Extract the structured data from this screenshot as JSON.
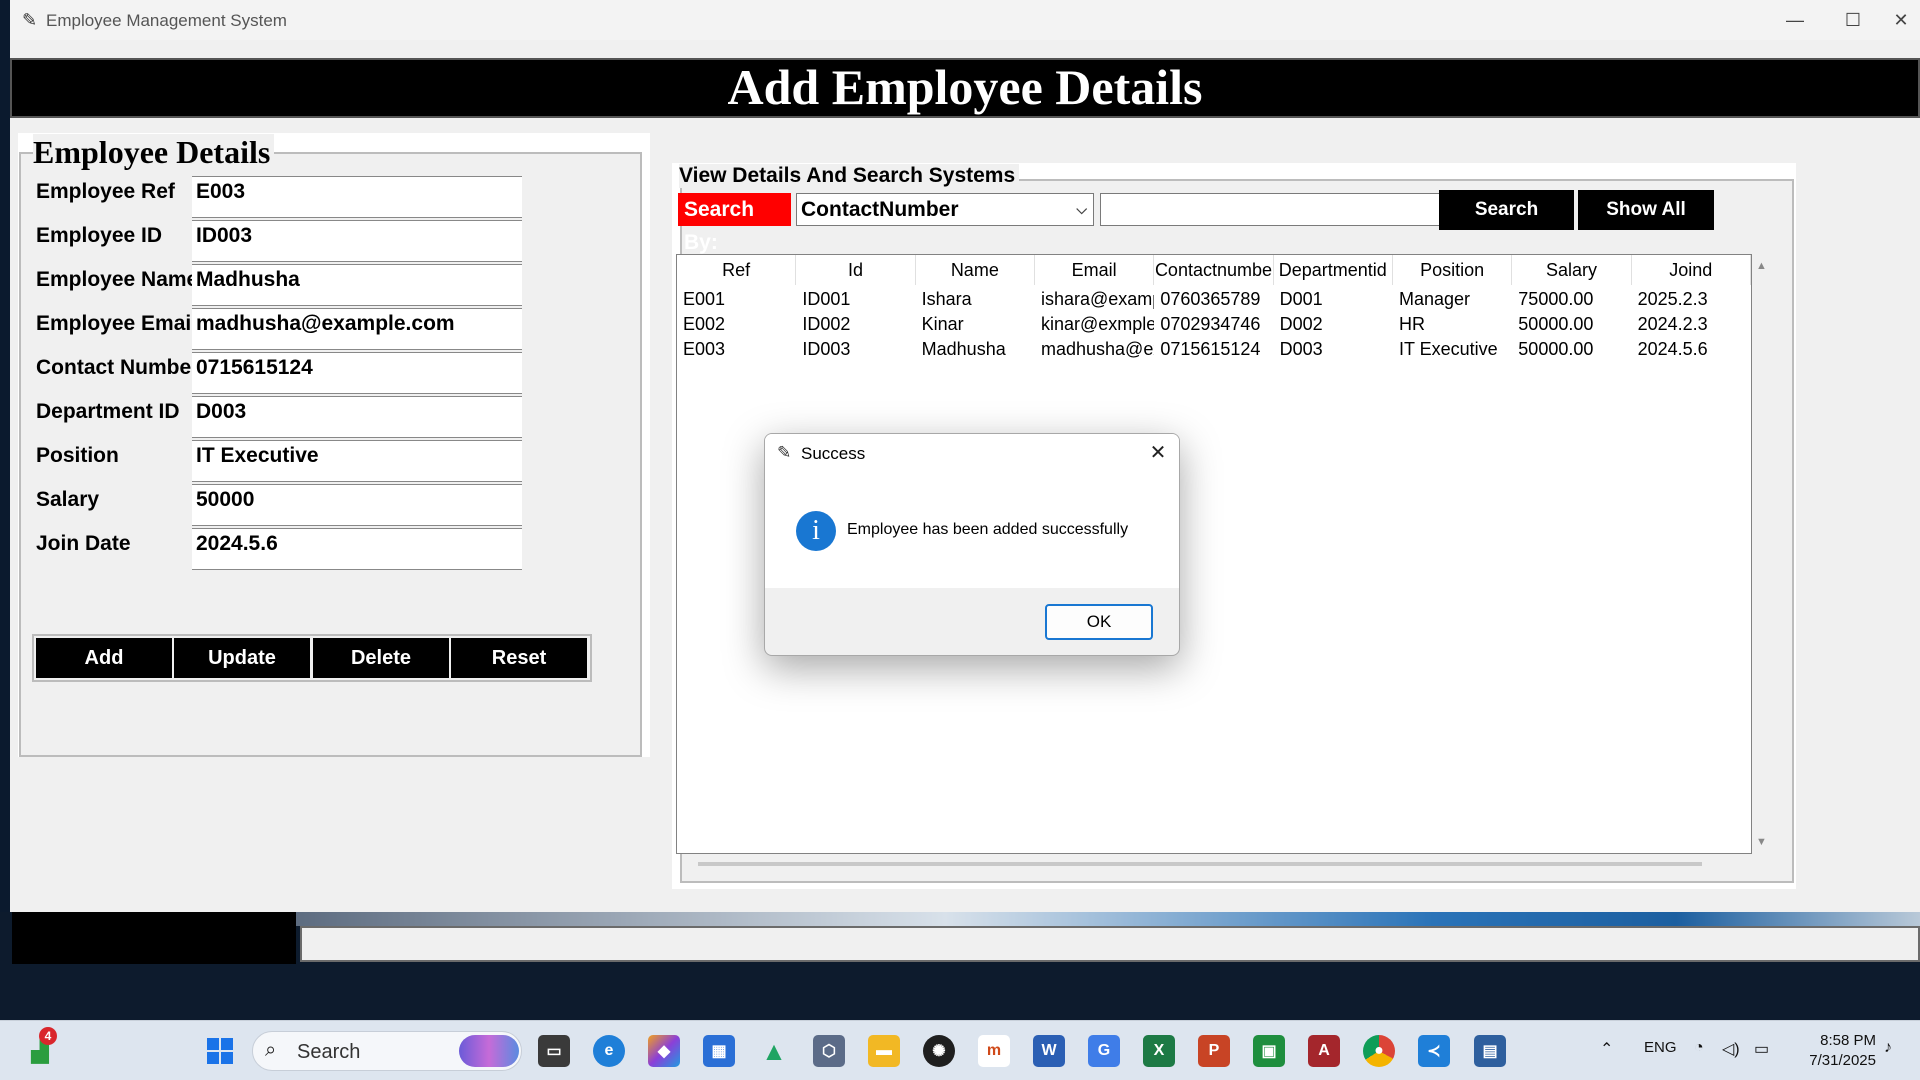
{
  "window": {
    "title": "Employee Management System",
    "banner": "Add Employee Details"
  },
  "left_panel": {
    "legend": "Employee Details",
    "fields": [
      {
        "label": "Employee Ref",
        "value": "E003"
      },
      {
        "label": "Employee ID",
        "value": "ID003"
      },
      {
        "label": "Employee Name",
        "value": "Madhusha"
      },
      {
        "label": "Employee Email",
        "value": "madhusha@example.com"
      },
      {
        "label": "Contact Number",
        "value": "0715615124"
      },
      {
        "label": "Department ID",
        "value": "D003"
      },
      {
        "label": "Position",
        "value": "IT Executive"
      },
      {
        "label": "Salary",
        "value": "50000"
      },
      {
        "label": "Join Date",
        "value": "2024.5.6"
      }
    ],
    "buttons": [
      "Add",
      "Update",
      "Delete",
      "Reset"
    ]
  },
  "right_panel": {
    "legend": "View Details And Search Systems",
    "search_by_label": "Search By:",
    "search_by_value": "ContactNumber",
    "search_value": "",
    "search_button": "Search",
    "show_all_button": "Show All",
    "table": {
      "headers": [
        "Ref",
        "Id",
        "Name",
        "Email",
        "Contactnumbe",
        "Departmentid",
        "Position",
        "Salary",
        "Joind"
      ],
      "rows": [
        [
          "E001",
          "ID001",
          "Ishara",
          "ishara@exampl",
          "0760365789",
          "D001",
          "Manager",
          "75000.00",
          "2025.2.3"
        ],
        [
          "E002",
          "ID002",
          "Kinar",
          "kinar@exmple.c",
          "0702934746",
          "D002",
          "HR",
          "50000.00",
          "2024.2.3"
        ],
        [
          "E003",
          "ID003",
          "Madhusha",
          "madhusha@ex",
          "0715615124",
          "D003",
          "IT Executive",
          "50000.00",
          "2024.5.6"
        ]
      ]
    }
  },
  "dialog": {
    "title": "Success",
    "message": "Employee has been added successfully",
    "ok_label": "OK",
    "icon": "info-icon"
  },
  "taskbar": {
    "search_label": "Search",
    "widget_badge": "4",
    "language": "ENG",
    "time": "8:58 PM",
    "date": "7/31/2025"
  },
  "colors": {
    "banner_bg": "#000000",
    "search_by_bg": "#ff0000",
    "button_bg": "#000000",
    "dialog_accent": "#1977d2"
  }
}
